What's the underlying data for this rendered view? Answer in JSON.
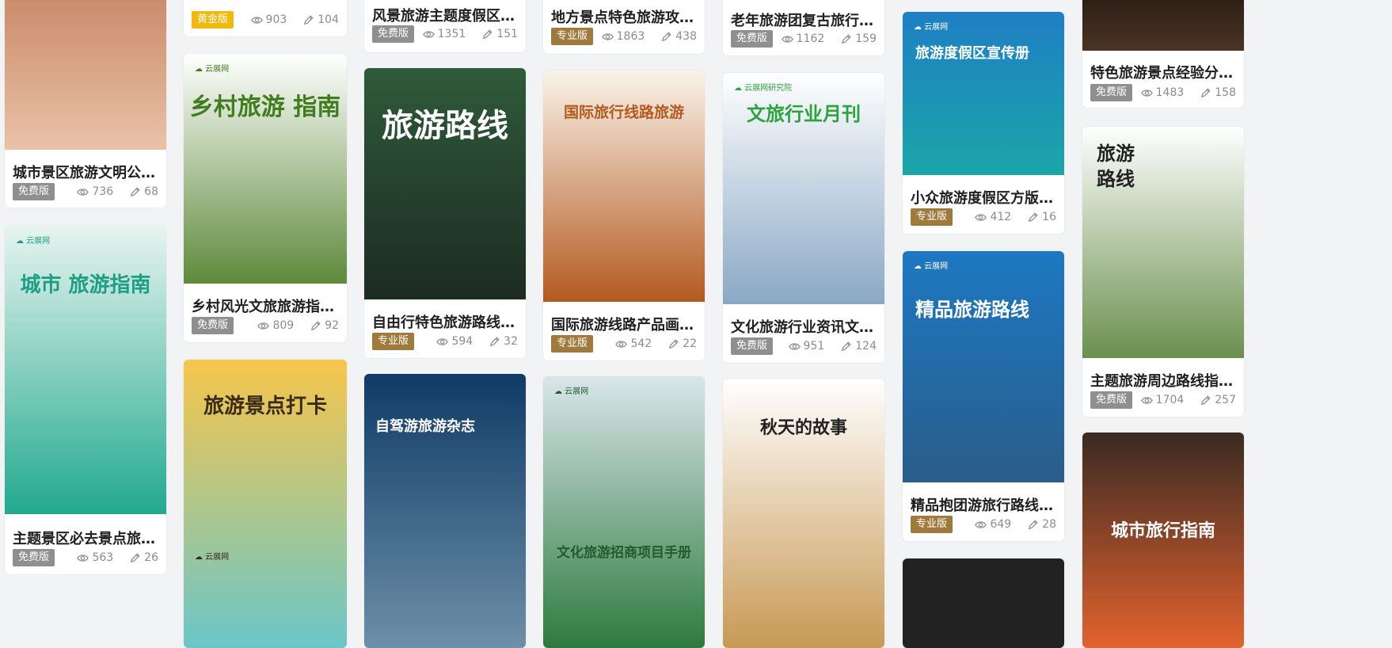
{
  "cards": [
    {
      "title": "城市景区旅游文明公约...",
      "badge": "免费版",
      "tier": "free",
      "views": "736",
      "likes": "68",
      "overlay": "",
      "colors": [
        "#c98b6a",
        "#e9c2a8"
      ]
    },
    {
      "title": "主题景区必去景点旅游...",
      "badge": "免费版",
      "tier": "free",
      "views": "563",
      "likes": "26",
      "overlay": "城市 旅游指南",
      "colors": [
        "#e7f4ef",
        "#22a98e"
      ]
    },
    {
      "title": "",
      "badge": "黄金版",
      "tier": "gold",
      "views": "903",
      "likes": "104",
      "overlay": "",
      "colors": [
        "#ffffff",
        "#ffffff"
      ]
    },
    {
      "title": "乡村风光文旅旅游指南...",
      "badge": "免费版",
      "tier": "free",
      "views": "809",
      "likes": "92",
      "overlay": "乡村旅游 指南",
      "colors": [
        "#ffffff",
        "#5e8a3a"
      ]
    },
    {
      "title": "",
      "badge": "",
      "tier": "",
      "views": "",
      "likes": "",
      "overlay": "旅游景点打卡",
      "colors": [
        "#f7c64b",
        "#6bc6c9"
      ]
    },
    {
      "title": "风景旅游主题度假区宣...",
      "badge": "免费版",
      "tier": "free",
      "views": "1351",
      "likes": "151",
      "overlay": "",
      "colors": [
        "#ffffff",
        "#ffffff"
      ]
    },
    {
      "title": "自由行特色旅游路线旅...",
      "badge": "专业版",
      "tier": "pro",
      "views": "594",
      "likes": "32",
      "overlay": "旅游路线",
      "colors": [
        "#2f5a3a",
        "#1d2b22"
      ]
    },
    {
      "title": "",
      "badge": "",
      "tier": "",
      "views": "",
      "likes": "",
      "overlay": "自驾游旅游杂志",
      "colors": [
        "#0f3b66",
        "#6d8fa8"
      ]
    },
    {
      "title": "地方景点特色旅游攻略...",
      "badge": "专业版",
      "tier": "pro",
      "views": "1863",
      "likes": "438",
      "overlay": "",
      "colors": [
        "#ffffff",
        "#ffffff"
      ]
    },
    {
      "title": "国际旅游线路产品画册...",
      "badge": "专业版",
      "tier": "pro",
      "views": "542",
      "likes": "22",
      "overlay": "国际旅行线路旅游",
      "colors": [
        "#faf3ea",
        "#b35a1f"
      ]
    },
    {
      "title": "",
      "badge": "",
      "tier": "",
      "views": "",
      "likes": "",
      "overlay": "文化旅游招商项目手册",
      "colors": [
        "#d9e6ea",
        "#2d7a3d"
      ]
    },
    {
      "title": "老年旅游团复古旅行纪...",
      "badge": "免费版",
      "tier": "free",
      "views": "1162",
      "likes": "159",
      "overlay": "",
      "colors": [
        "#ffffff",
        "#ffffff"
      ]
    },
    {
      "title": "文化旅游行业资讯文旅...",
      "badge": "免费版",
      "tier": "free",
      "views": "951",
      "likes": "124",
      "overlay": "文旅行业月刊",
      "colors": [
        "#ffffff",
        "#8aa8c4"
      ]
    },
    {
      "title": "",
      "badge": "",
      "tier": "",
      "views": "",
      "likes": "",
      "overlay": "秋天的故事",
      "colors": [
        "#ffffff",
        "#c79a55"
      ]
    },
    {
      "title": "小众旅游度假区方版宣...",
      "badge": "专业版",
      "tier": "pro",
      "views": "412",
      "likes": "16",
      "overlay": "旅游度假区宣传册",
      "colors": [
        "#1e7fc4",
        "#1ba6a8"
      ]
    },
    {
      "title": "精品抱团游旅行路线旅...",
      "badge": "专业版",
      "tier": "pro",
      "views": "649",
      "likes": "28",
      "overlay": "精品旅游路线",
      "colors": [
        "#1d78c2",
        "#2a5d8a"
      ]
    },
    {
      "title": "",
      "badge": "",
      "tier": "",
      "views": "",
      "likes": "",
      "overlay": "",
      "colors": [
        "#222222",
        "#222222"
      ]
    },
    {
      "title": "特色旅游景点经验分享...",
      "badge": "免费版",
      "tier": "free",
      "views": "1483",
      "likes": "158",
      "overlay": "",
      "colors": [
        "#2a1f16",
        "#4a3323"
      ]
    },
    {
      "title": "主题旅游周边路线指南...",
      "badge": "免费版",
      "tier": "free",
      "views": "1704",
      "likes": "257",
      "overlay": "旅游 路线",
      "colors": [
        "#ffffff",
        "#6a8f4e"
      ]
    },
    {
      "title": "",
      "badge": "",
      "tier": "",
      "views": "",
      "likes": "",
      "overlay": "城市旅行指南",
      "colors": [
        "#3a2a22",
        "#e3622f"
      ]
    }
  ]
}
